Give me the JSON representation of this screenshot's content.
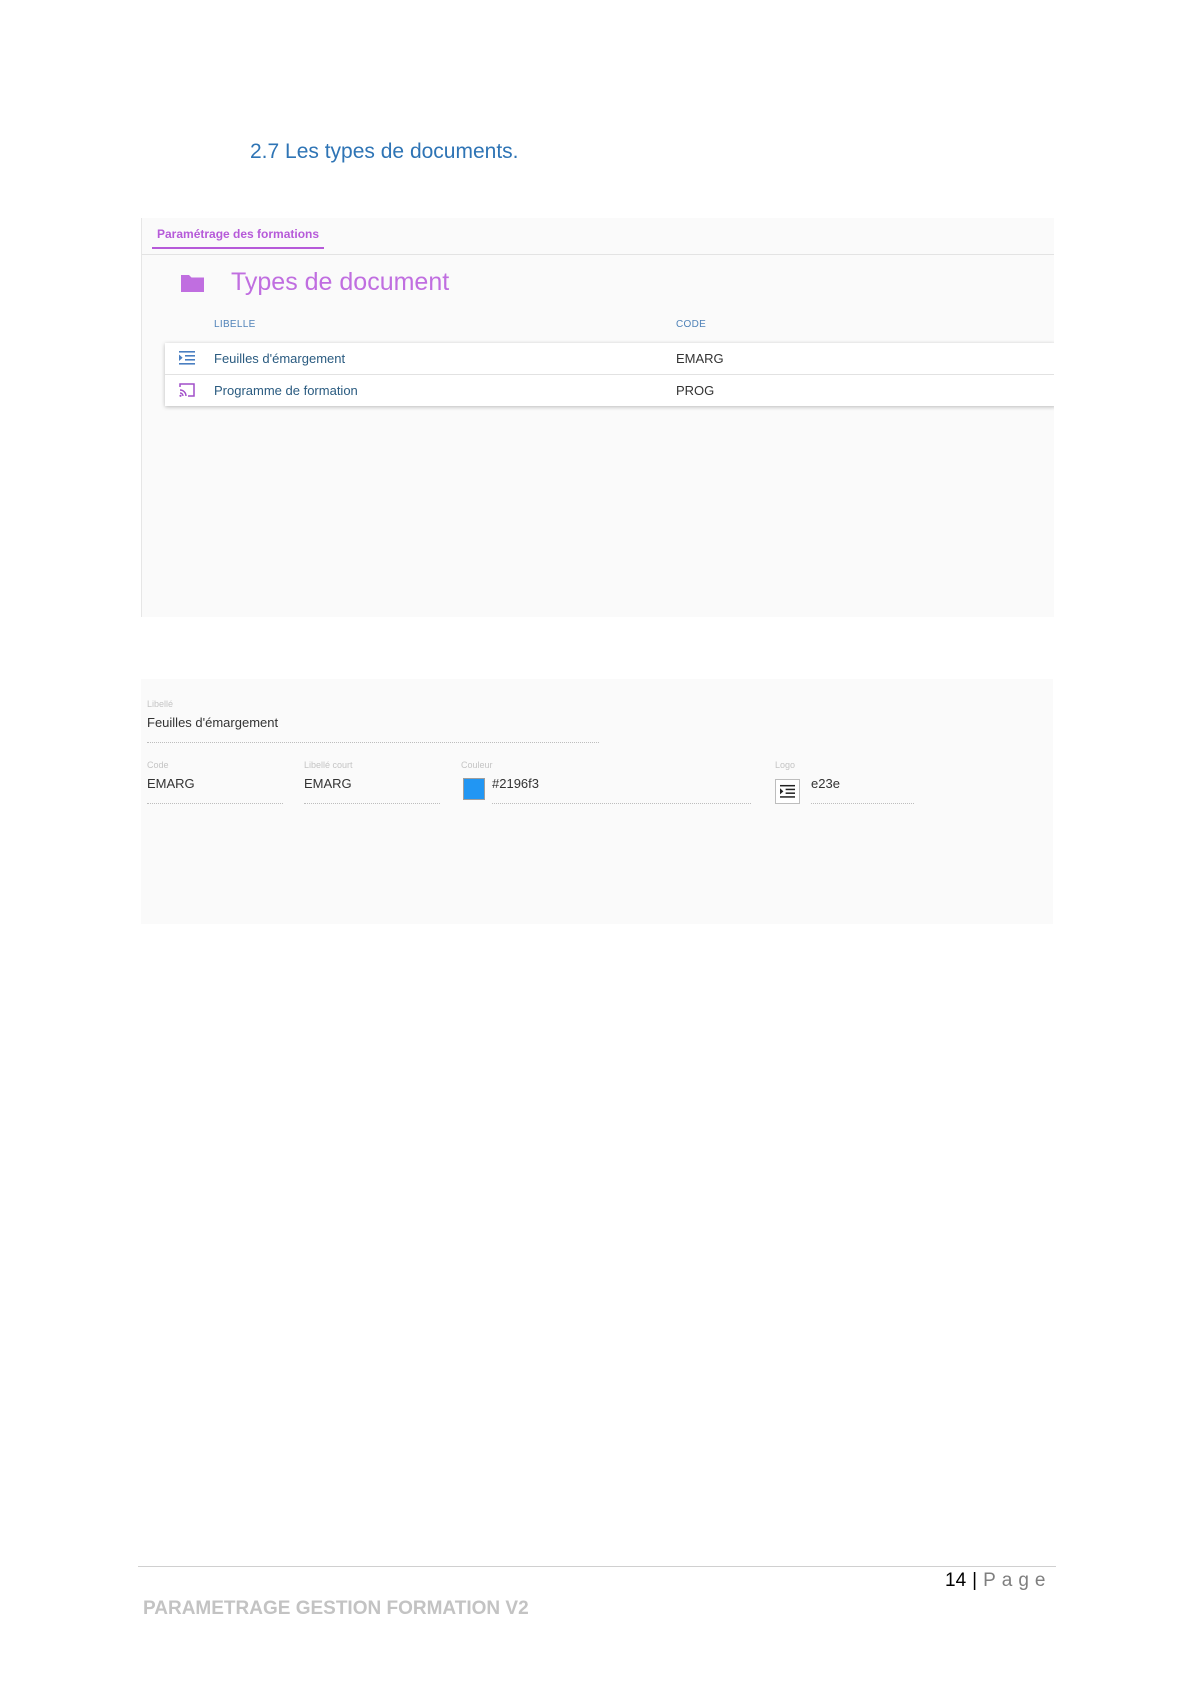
{
  "heading": "2.7 Les types de documents.",
  "list": {
    "tab_label": "Paramétrage des formations",
    "title": "Types de document",
    "columns": {
      "libelle": "LIBELLE",
      "code": "CODE"
    },
    "rows": [
      {
        "label": "Feuilles d'émargement",
        "code": "EMARG",
        "icon": "format-indent-icon",
        "icon_color": "#4a7fc1"
      },
      {
        "label": "Programme de formation",
        "code": "PROG",
        "icon": "cast-icon",
        "icon_color": "#a14fc9"
      }
    ],
    "accent_color": "#b65ad9"
  },
  "form": {
    "libelle": {
      "label": "Libellé",
      "value": "Feuilles d'émargement"
    },
    "code": {
      "label": "Code",
      "value": "EMARG"
    },
    "libelle_court": {
      "label": "Libellé court",
      "value": "EMARG"
    },
    "couleur": {
      "label": "Couleur",
      "value": "#2196f3",
      "swatch_color": "#2196f3"
    },
    "logo": {
      "label": "Logo",
      "value": "e23e",
      "icon": "format-indent-icon"
    }
  },
  "footer": {
    "page_number": "14",
    "separator": "|",
    "page_word": "Page",
    "doc_title": "PARAMETRAGE GESTION FORMATION V2"
  }
}
